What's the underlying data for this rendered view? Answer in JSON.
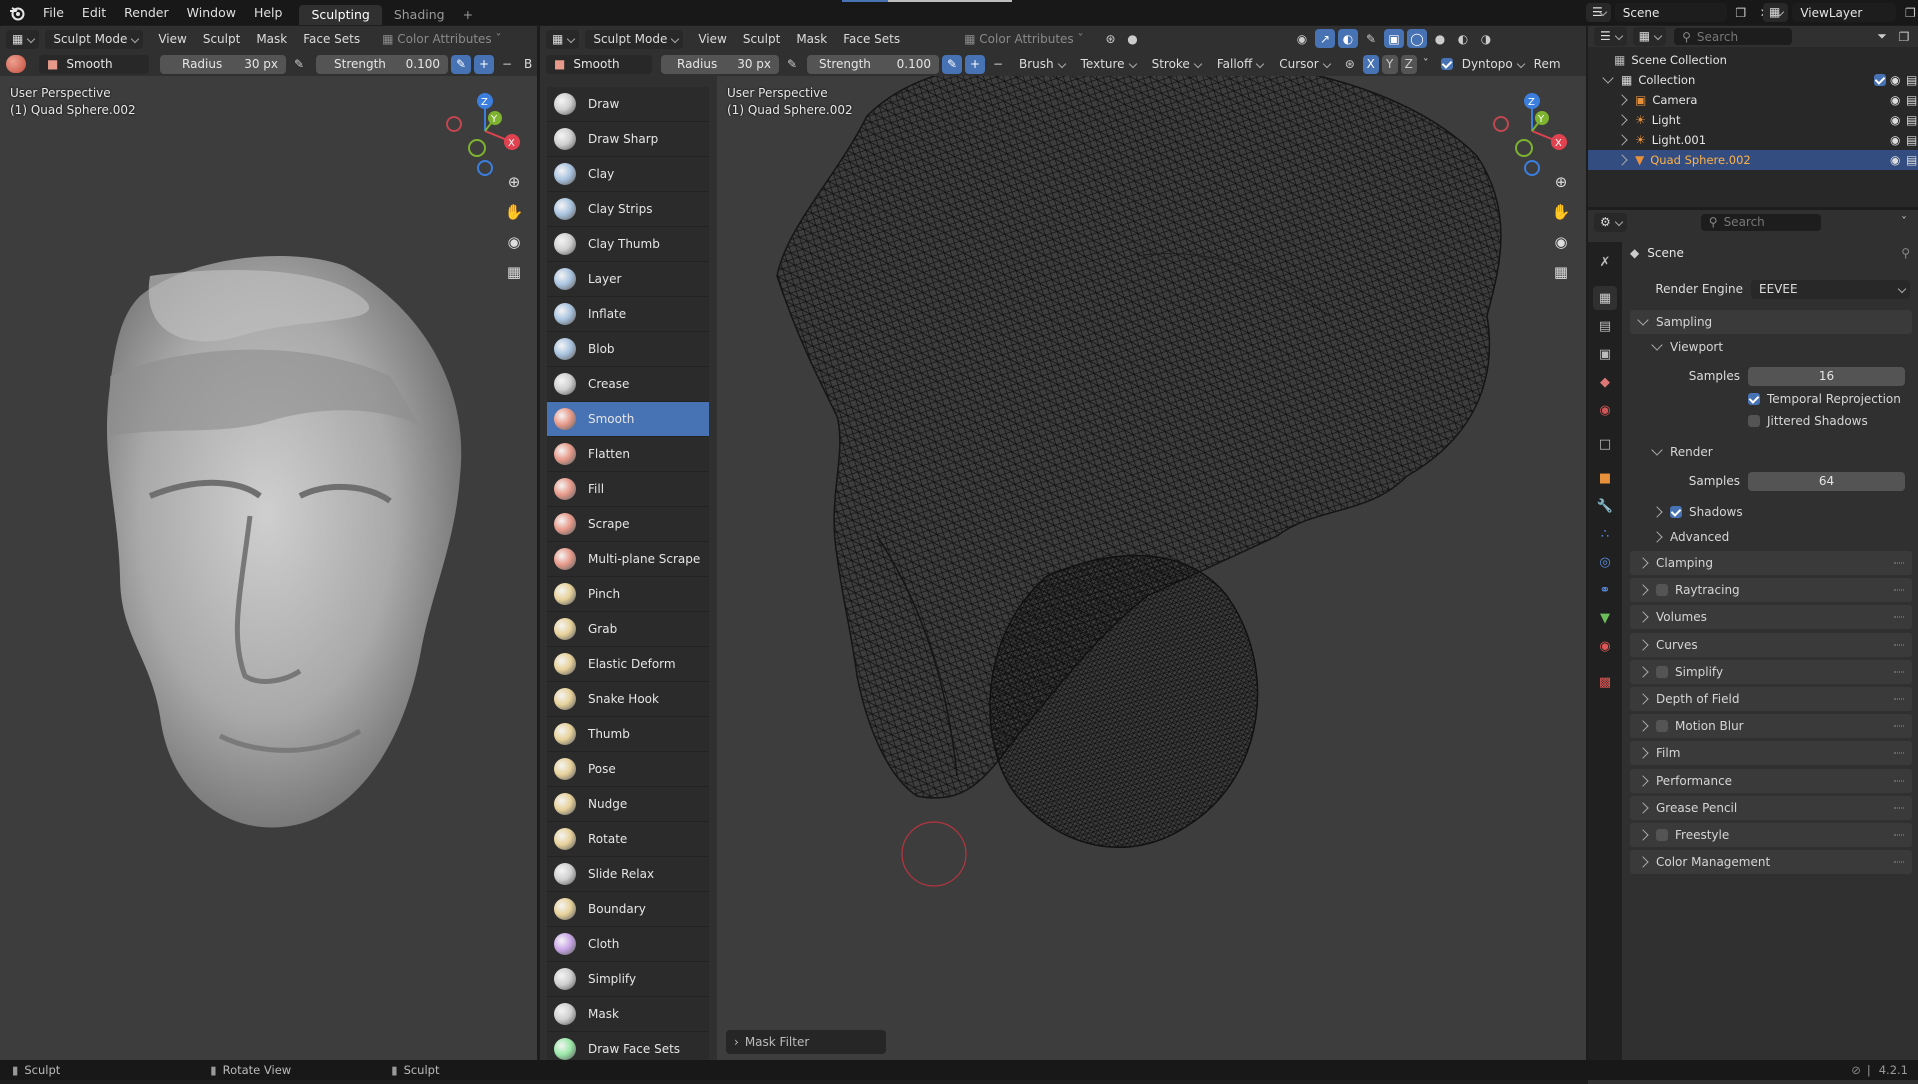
{
  "topbar": {
    "menus": [
      "File",
      "Edit",
      "Render",
      "Window",
      "Help"
    ],
    "workspaces": [
      {
        "label": "Sculpting",
        "active": true
      },
      {
        "label": "Shading",
        "active": false
      }
    ],
    "add_tab": "+",
    "scene": "Scene",
    "viewlayer": "ViewLayer"
  },
  "left_editor": {
    "mode": "Sculpt Mode",
    "menus": [
      "View",
      "Sculpt",
      "Mask",
      "Face Sets"
    ],
    "color_attr": "Color Attributes",
    "brush": "Smooth",
    "radius_label": "Radius",
    "radius_value": "30 px",
    "strength_label": "Strength",
    "strength_value": "0.100",
    "overflow_char": "B",
    "perspective": "User Perspective",
    "object": "(1) Quad Sphere.002"
  },
  "center_editor": {
    "mode": "Sculpt Mode",
    "menus": [
      "View",
      "Sculpt",
      "Mask",
      "Face Sets"
    ],
    "color_attr": "Color Attributes",
    "brush": "Smooth",
    "radius_label": "Radius",
    "radius_value": "30 px",
    "strength_label": "Strength",
    "strength_value": "0.100",
    "tool_menus": [
      "Brush",
      "Texture",
      "Stroke",
      "Falloff",
      "Cursor"
    ],
    "axes": [
      "X",
      "Y",
      "Z"
    ],
    "dyntopo": "Dyntopo",
    "remesh": "Rem",
    "perspective": "User Perspective",
    "object": "(1) Quad Sphere.002",
    "mask_filter": "Mask Filter"
  },
  "gizmo": {
    "x": "X",
    "y": "Y",
    "z": "Z",
    "x_color": "#e0424f",
    "y_color": "#7db32f",
    "z_color": "#3c7ede"
  },
  "brushes": [
    {
      "label": "Draw",
      "color": "#d0d0d0",
      "icon": "draw-brush-icon"
    },
    {
      "label": "Draw Sharp",
      "color": "#d0d0d0",
      "icon": "draw-sharp-brush-icon"
    },
    {
      "label": "Clay",
      "color": "#a9c4e0",
      "icon": "clay-brush-icon"
    },
    {
      "label": "Clay Strips",
      "color": "#a9c4e0",
      "icon": "clay-strips-brush-icon"
    },
    {
      "label": "Clay Thumb",
      "color": "#d0d0d0",
      "icon": "clay-thumb-brush-icon"
    },
    {
      "label": "Layer",
      "color": "#a9c4e0",
      "icon": "layer-brush-icon"
    },
    {
      "label": "Inflate",
      "color": "#a9c4e0",
      "icon": "inflate-brush-icon"
    },
    {
      "label": "Blob",
      "color": "#a9c4e0",
      "icon": "blob-brush-icon"
    },
    {
      "label": "Crease",
      "color": "#d0d0d0",
      "icon": "crease-brush-icon"
    },
    {
      "label": "Smooth",
      "color": "#e89a8a",
      "icon": "smooth-brush-icon",
      "selected": true
    },
    {
      "label": "Flatten",
      "color": "#e89a8a",
      "icon": "flatten-brush-icon"
    },
    {
      "label": "Fill",
      "color": "#e89a8a",
      "icon": "fill-brush-icon"
    },
    {
      "label": "Scrape",
      "color": "#e89a8a",
      "icon": "scrape-brush-icon"
    },
    {
      "label": "Multi-plane Scrape",
      "color": "#e89a8a",
      "icon": "multiplane-scrape-brush-icon"
    },
    {
      "label": "Pinch",
      "color": "#e8d29a",
      "icon": "pinch-brush-icon"
    },
    {
      "label": "Grab",
      "color": "#e8d29a",
      "icon": "grab-brush-icon"
    },
    {
      "label": "Elastic Deform",
      "color": "#e8d29a",
      "icon": "elastic-deform-brush-icon"
    },
    {
      "label": "Snake Hook",
      "color": "#e8d29a",
      "icon": "snake-hook-brush-icon"
    },
    {
      "label": "Thumb",
      "color": "#e8d29a",
      "icon": "thumb-brush-icon"
    },
    {
      "label": "Pose",
      "color": "#e8d29a",
      "icon": "pose-brush-icon"
    },
    {
      "label": "Nudge",
      "color": "#e8d29a",
      "icon": "nudge-brush-icon"
    },
    {
      "label": "Rotate",
      "color": "#e8d29a",
      "icon": "rotate-brush-icon"
    },
    {
      "label": "Slide Relax",
      "color": "#d0d0d0",
      "icon": "slide-relax-brush-icon"
    },
    {
      "label": "Boundary",
      "color": "#e8d29a",
      "icon": "boundary-brush-icon"
    },
    {
      "label": "Cloth",
      "color": "#c9a6e8",
      "icon": "cloth-brush-icon"
    },
    {
      "label": "Simplify",
      "color": "#d0d0d0",
      "icon": "simplify-brush-icon"
    },
    {
      "label": "Mask",
      "color": "#d0d0d0",
      "icon": "mask-brush-icon"
    },
    {
      "label": "Draw Face Sets",
      "color": "#9ae8a8",
      "icon": "draw-face-sets-brush-icon"
    }
  ],
  "outliner": {
    "search_placeholder": "Search",
    "root": "Scene Collection",
    "collection": "Collection",
    "items": [
      {
        "label": "Camera",
        "icon": "camera-icon"
      },
      {
        "label": "Light",
        "icon": "light-icon"
      },
      {
        "label": "Light.001",
        "icon": "light-icon"
      },
      {
        "label": "Quad Sphere.002",
        "icon": "mesh-icon",
        "selected": true
      }
    ]
  },
  "properties": {
    "search_placeholder": "Search",
    "context": "Scene",
    "render_engine_label": "Render Engine",
    "render_engine": "EEVEE",
    "sampling": "Sampling",
    "viewport": "Viewport",
    "viewport_samples_label": "Samples",
    "viewport_samples": "16",
    "temporal_reprojection": "Temporal Reprojection",
    "jittered_shadows": "Jittered Shadows",
    "render": "Render",
    "render_samples_label": "Samples",
    "render_samples": "64",
    "shadows": "Shadows",
    "advanced": "Advanced",
    "panels": [
      {
        "label": "Clamping",
        "checkbox": false
      },
      {
        "label": "Raytracing",
        "checkbox": true
      },
      {
        "label": "Volumes",
        "checkbox": false
      },
      {
        "label": "Curves",
        "checkbox": false
      },
      {
        "label": "Simplify",
        "checkbox": true
      },
      {
        "label": "Depth of Field",
        "checkbox": false
      },
      {
        "label": "Motion Blur",
        "checkbox": true
      },
      {
        "label": "Film",
        "checkbox": false
      },
      {
        "label": "Performance",
        "checkbox": false
      },
      {
        "label": "Grease Pencil",
        "checkbox": false
      },
      {
        "label": "Freestyle",
        "checkbox": true
      },
      {
        "label": "Color Management",
        "checkbox": false
      }
    ]
  },
  "statusbar": {
    "items": [
      "Sculpt",
      "Rotate View",
      "Sculpt"
    ],
    "version": "4.2.1"
  }
}
